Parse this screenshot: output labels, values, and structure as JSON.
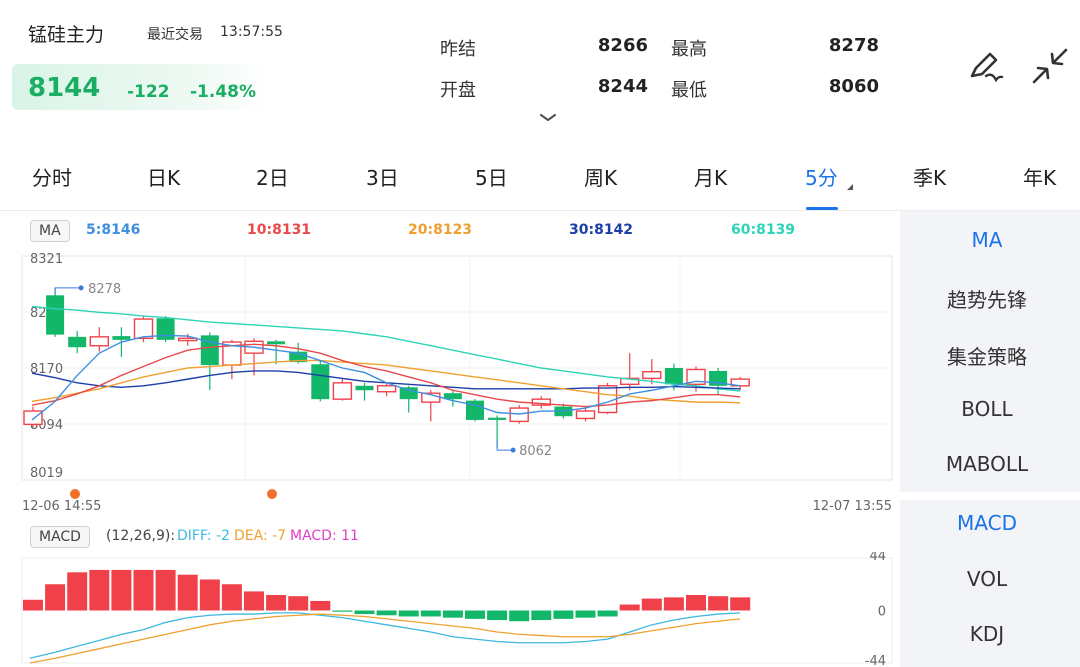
{
  "header": {
    "symbol": "锰硅主力",
    "last_trade_label": "最近交易",
    "last_trade_time": "13:57:55",
    "price": "8144",
    "change": "-122",
    "change_pct": "-1.48%",
    "stats": {
      "prev_settle_label": "昨结",
      "prev_settle_value": "8266",
      "open_label": "开盘",
      "open_value": "8244",
      "high_label": "最高",
      "high_value": "8278",
      "low_label": "最低",
      "low_value": "8060"
    },
    "icons": {
      "draw": "pen-draw-icon",
      "collapse": "collapse-arrows-icon",
      "expand": "chevron-down-icon"
    }
  },
  "tabs": [
    {
      "label": "分时"
    },
    {
      "label": "日K"
    },
    {
      "label": "2日"
    },
    {
      "label": "3日"
    },
    {
      "label": "5日"
    },
    {
      "label": "周K"
    },
    {
      "label": "月K"
    },
    {
      "label": "5分",
      "active": true
    },
    {
      "label": "季K"
    },
    {
      "label": "年K"
    }
  ],
  "ma_bar": {
    "badge": "MA",
    "values": [
      {
        "text": "5:8146",
        "color": "#3d8fe0"
      },
      {
        "text": "10:8131",
        "color": "#e84a4a"
      },
      {
        "text": "20:8123",
        "color": "#f0a030"
      },
      {
        "text": "30:8142",
        "color": "#1b3fa8"
      },
      {
        "text": "60:8139",
        "color": "#2fd4b8"
      }
    ]
  },
  "price_axis": [
    "8321",
    "8246",
    "8170",
    "8094",
    "8019"
  ],
  "time_axis": {
    "start": "12-06 14:55",
    "end": "12-07 13:55"
  },
  "annotations": {
    "high": "8278",
    "low": "8062"
  },
  "macd_bar": {
    "badge": "MACD",
    "params": "(12,26,9):",
    "diff": "DIFF: -2",
    "dea": "DEA: -7",
    "macd": "MACD: 11"
  },
  "macd_axis": [
    "44",
    "0",
    "-44"
  ],
  "side_panel": {
    "main_items": [
      {
        "label": "MA",
        "active": true
      },
      {
        "label": "趋势先锋"
      },
      {
        "label": "集金策略"
      },
      {
        "label": "BOLL"
      },
      {
        "label": "MABOLL"
      }
    ],
    "sub_items": [
      {
        "label": "MACD",
        "active": true
      },
      {
        "label": "VOL"
      },
      {
        "label": "KDJ"
      }
    ]
  },
  "colors": {
    "up": "#f0414a",
    "down": "#12b76a",
    "accent": "#1a73e8",
    "marker": "#f2702c"
  },
  "chart_data": {
    "type": "candlestick",
    "y_range": [
      8019,
      8321
    ],
    "candles": [
      {
        "o": 8094,
        "c": 8112,
        "h": 8118,
        "l": 8090
      },
      {
        "o": 8268,
        "c": 8215,
        "h": 8278,
        "l": 8212
      },
      {
        "o": 8212,
        "c": 8198,
        "h": 8220,
        "l": 8190
      },
      {
        "o": 8200,
        "c": 8212,
        "h": 8225,
        "l": 8192
      },
      {
        "o": 8213,
        "c": 8208,
        "h": 8225,
        "l": 8185
      },
      {
        "o": 8210,
        "c": 8236,
        "h": 8240,
        "l": 8205
      },
      {
        "o": 8237,
        "c": 8208,
        "h": 8240,
        "l": 8205
      },
      {
        "o": 8207,
        "c": 8210,
        "h": 8216,
        "l": 8200
      },
      {
        "o": 8214,
        "c": 8174,
        "h": 8218,
        "l": 8140
      },
      {
        "o": 8174,
        "c": 8205,
        "h": 8208,
        "l": 8155
      },
      {
        "o": 8190,
        "c": 8206,
        "h": 8210,
        "l": 8160
      },
      {
        "o": 8206,
        "c": 8202,
        "h": 8208,
        "l": 8175
      },
      {
        "o": 8192,
        "c": 8178,
        "h": 8204,
        "l": 8176
      },
      {
        "o": 8175,
        "c": 8128,
        "h": 8180,
        "l": 8125
      },
      {
        "o": 8128,
        "c": 8150,
        "h": 8155,
        "l": 8126
      },
      {
        "o": 8146,
        "c": 8140,
        "h": 8150,
        "l": 8126
      },
      {
        "o": 8138,
        "c": 8146,
        "h": 8150,
        "l": 8132
      },
      {
        "o": 8144,
        "c": 8128,
        "h": 8146,
        "l": 8110
      },
      {
        "o": 8124,
        "c": 8136,
        "h": 8140,
        "l": 8098
      },
      {
        "o": 8136,
        "c": 8128,
        "h": 8140,
        "l": 8118
      },
      {
        "o": 8126,
        "c": 8100,
        "h": 8128,
        "l": 8098
      },
      {
        "o": 8103,
        "c": 8100,
        "h": 8106,
        "l": 8062
      },
      {
        "o": 8098,
        "c": 8116,
        "h": 8120,
        "l": 8095
      },
      {
        "o": 8120,
        "c": 8128,
        "h": 8132,
        "l": 8115
      },
      {
        "o": 8118,
        "c": 8105,
        "h": 8122,
        "l": 8102
      },
      {
        "o": 8102,
        "c": 8112,
        "h": 8118,
        "l": 8098
      },
      {
        "o": 8110,
        "c": 8146,
        "h": 8150,
        "l": 8108
      },
      {
        "o": 8148,
        "c": 8156,
        "h": 8190,
        "l": 8140
      },
      {
        "o": 8156,
        "c": 8165,
        "h": 8182,
        "l": 8148
      },
      {
        "o": 8170,
        "c": 8148,
        "h": 8176,
        "l": 8140
      },
      {
        "o": 8148,
        "c": 8168,
        "h": 8172,
        "l": 8138
      },
      {
        "o": 8166,
        "c": 8146,
        "h": 8170,
        "l": 8134
      },
      {
        "o": 8146,
        "c": 8155,
        "h": 8158,
        "l": 8140
      }
    ],
    "ma5": [
      8100,
      8125,
      8160,
      8190,
      8205,
      8212,
      8214,
      8213,
      8205,
      8200,
      8198,
      8194,
      8190,
      8180,
      8170,
      8164,
      8150,
      8140,
      8134,
      8126,
      8120,
      8110,
      8108,
      8112,
      8112,
      8116,
      8124,
      8135,
      8140,
      8146,
      8152,
      8150,
      8146
    ],
    "ma10": [
      8120,
      8126,
      8135,
      8146,
      8160,
      8172,
      8184,
      8194,
      8198,
      8200,
      8202,
      8200,
      8196,
      8190,
      8180,
      8172,
      8166,
      8158,
      8150,
      8140,
      8134,
      8128,
      8124,
      8122,
      8120,
      8118,
      8120,
      8124,
      8126,
      8130,
      8134,
      8134,
      8131
    ],
    "ma20": [
      8125,
      8130,
      8136,
      8142,
      8150,
      8158,
      8164,
      8170,
      8172,
      8174,
      8176,
      8178,
      8180,
      8180,
      8178,
      8176,
      8174,
      8170,
      8166,
      8162,
      8158,
      8154,
      8150,
      8146,
      8142,
      8138,
      8134,
      8132,
      8128,
      8126,
      8124,
      8124,
      8123
    ],
    "ma30": [
      8163,
      8157,
      8150,
      8146,
      8144,
      8146,
      8150,
      8155,
      8160,
      8164,
      8166,
      8166,
      8164,
      8160,
      8156,
      8152,
      8150,
      8148,
      8146,
      8144,
      8142,
      8142,
      8142,
      8142,
      8142,
      8143,
      8143,
      8144,
      8144,
      8145,
      8144,
      8143,
      8142
    ],
    "ma60": [
      8253,
      8250,
      8248,
      8245,
      8243,
      8240,
      8238,
      8235,
      8232,
      8230,
      8228,
      8226,
      8224,
      8222,
      8220,
      8216,
      8212,
      8206,
      8200,
      8194,
      8188,
      8182,
      8176,
      8170,
      8166,
      8162,
      8158,
      8155,
      8152,
      8148,
      8146,
      8142,
      8139
    ],
    "macd_range": [
      -44,
      44
    ],
    "macd_hist": [
      9,
      22,
      32,
      34,
      34,
      34,
      34,
      30,
      26,
      22,
      16,
      13,
      12,
      8,
      -1,
      -3,
      -4,
      -5,
      -5,
      -6,
      -7,
      -8,
      -9,
      -8,
      -7,
      -6,
      -5,
      5,
      10,
      11,
      13,
      12,
      11
    ],
    "diff": [
      -40,
      -35,
      -30,
      -25,
      -20,
      -16,
      -10,
      -6,
      -4,
      -3,
      -3,
      -2,
      -2,
      -4,
      -6,
      -9,
      -12,
      -15,
      -18,
      -22,
      -24,
      -26,
      -27,
      -27,
      -27,
      -26,
      -24,
      -18,
      -12,
      -8,
      -5,
      -3,
      -2
    ],
    "dea": [
      -44,
      -40,
      -36,
      -32,
      -28,
      -24,
      -20,
      -16,
      -12,
      -9,
      -7,
      -5,
      -4,
      -3,
      -4,
      -5,
      -7,
      -9,
      -11,
      -13,
      -15,
      -18,
      -20,
      -21,
      -22,
      -22,
      -22,
      -20,
      -17,
      -14,
      -11,
      -9,
      -7
    ]
  }
}
